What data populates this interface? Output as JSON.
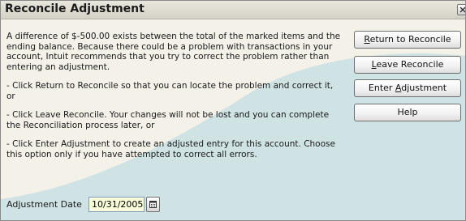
{
  "window": {
    "title": "Reconcile Adjustment",
    "close_icon": "close-icon"
  },
  "message": {
    "intro": "A difference of $-500.00 exists between the total of the marked items and the ending balance. Because there could be a problem with transactions in your account, Intuit recommends that you try to correct the problem rather than entering an adjustment.",
    "option_return": "- Click Return to Reconcile so that you can locate the problem and correct it, or",
    "option_leave": "- Click Leave Reconcile. Your changes will not be lost and you can complete the Reconciliation process later, or",
    "option_enter": "- Click Enter Adjustment to create an adjusted entry for this account. Choose this option only if you have attempted to correct all errors."
  },
  "buttons": {
    "return": {
      "pre": "",
      "key": "R",
      "post": "eturn to Reconcile"
    },
    "leave": {
      "pre": "",
      "key": "L",
      "post": "eave Reconcile"
    },
    "enter": {
      "pre": "Enter ",
      "key": "A",
      "post": "djustment"
    },
    "help": {
      "label": "Help"
    }
  },
  "adjustment_date": {
    "label": "Adjustment Date",
    "value": "10/31/2005",
    "calendar_icon": "calendar-icon"
  },
  "colors": {
    "dialog_bg": "#f3f1e8",
    "swoosh": "#cfe2e4",
    "date_field_bg": "#fafcd9"
  }
}
